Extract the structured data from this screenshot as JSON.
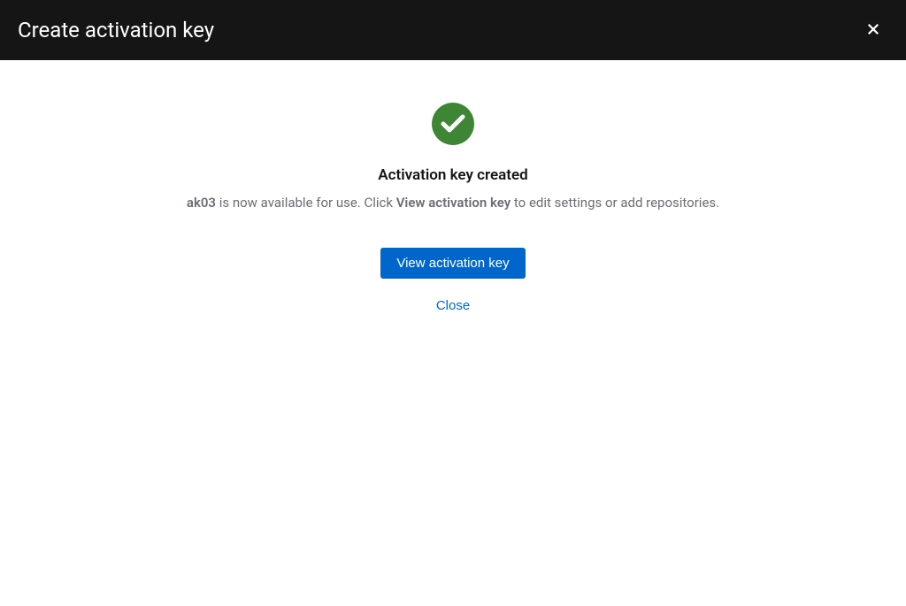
{
  "header": {
    "title": "Create activation key"
  },
  "content": {
    "heading": "Activation key created",
    "key_name": "ak03",
    "description_part1": " is now available for use. Click ",
    "description_bold": "View activation key",
    "description_part2": " to edit settings or add repositories.",
    "primary_button": "View activation key",
    "close_link": "Close"
  }
}
